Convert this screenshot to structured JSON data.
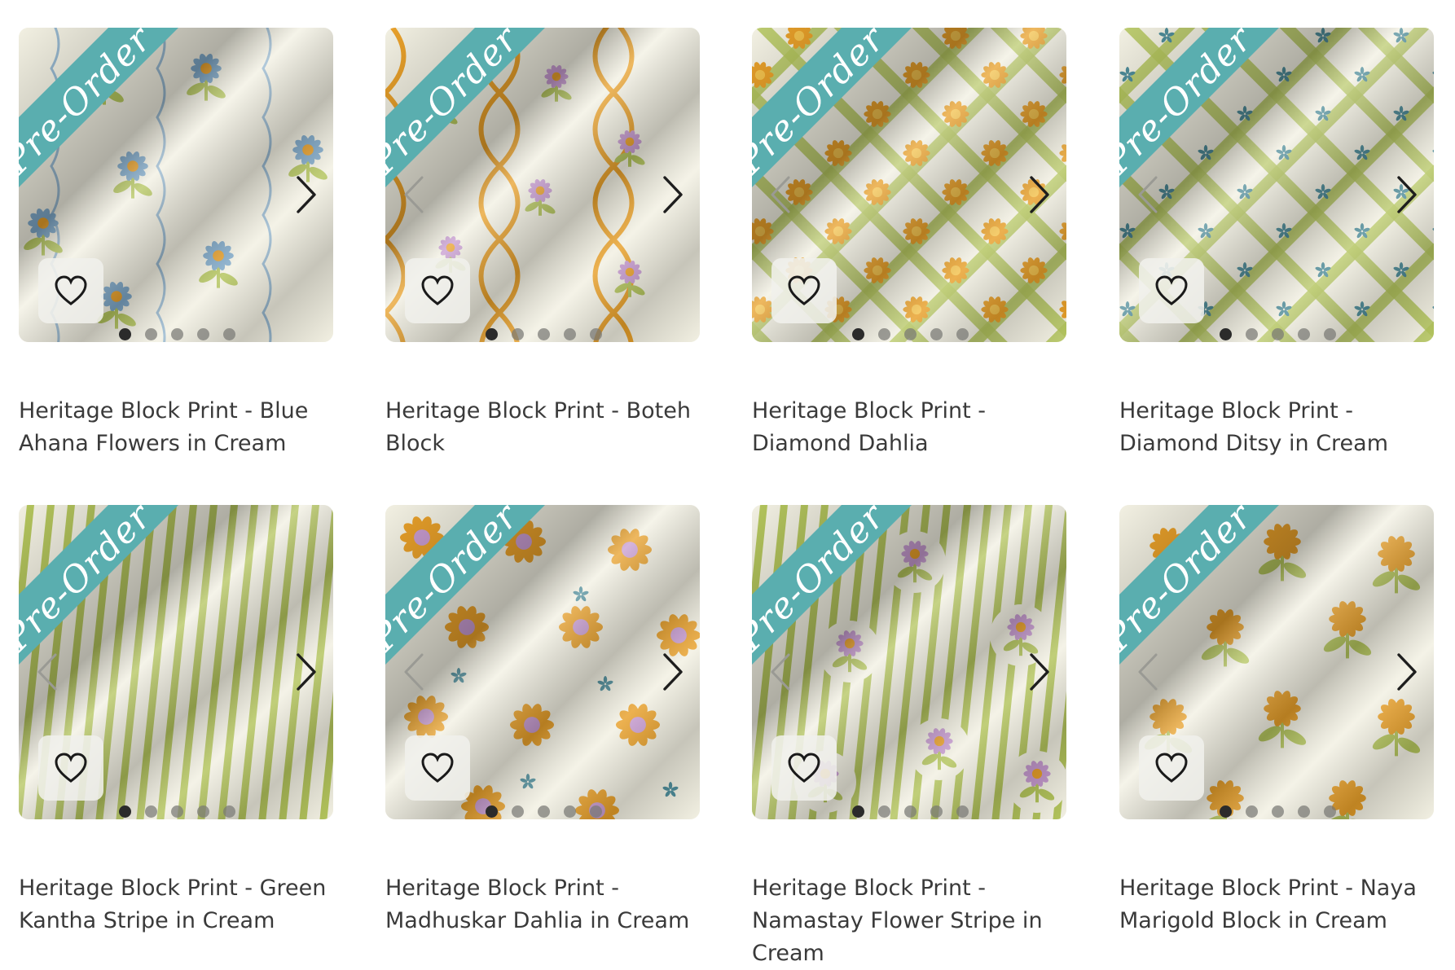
{
  "ribbon_label": "Pre-Order",
  "colors": {
    "ribbon": "#5aaeaf",
    "cream": "#f2f0e2",
    "green": "#b3c45c",
    "gold": "#e8a02a",
    "blue": "#7fa9c9",
    "purple": "#c79bd0",
    "teal": "#4f8d9a"
  },
  "icons": {
    "wishlist": "heart-icon",
    "prev": "chevron-left-icon",
    "next": "chevron-right-icon"
  },
  "products": [
    {
      "title": "Heritage Block Print - Blue Ahana Flowers in Cream",
      "pattern": "blue-ahana",
      "slides": 5,
      "active_slide": 1
    },
    {
      "title": "Heritage Block Print - Boteh Block",
      "pattern": "boteh",
      "slides": 5,
      "active_slide": 1
    },
    {
      "title": "Heritage Block Print - Diamond Dahlia",
      "pattern": "diamond-dahlia",
      "slides": 5,
      "active_slide": 1
    },
    {
      "title": "Heritage Block Print - Diamond Ditsy in Cream",
      "pattern": "diamond-ditsy",
      "slides": 5,
      "active_slide": 1
    },
    {
      "title": "Heritage Block Print - Green Kantha Stripe in Cream",
      "pattern": "kantha-stripe",
      "slides": 5,
      "active_slide": 1
    },
    {
      "title": "Heritage Block Print - Madhuskar Dahlia in Cream",
      "pattern": "madhuskar-dahlia",
      "slides": 5,
      "active_slide": 1
    },
    {
      "title": "Heritage Block Print - Namastay Flower Stripe in Cream",
      "pattern": "namastay-stripe",
      "slides": 5,
      "active_slide": 1
    },
    {
      "title": "Heritage Block Print - Naya Marigold Block in Cream",
      "pattern": "naya-marigold",
      "slides": 5,
      "active_slide": 1
    }
  ]
}
